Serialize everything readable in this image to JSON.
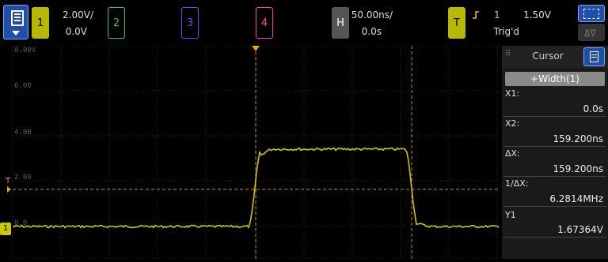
{
  "menu": {
    "icon": "menu-icon"
  },
  "channels": [
    {
      "num": "1",
      "color": "#c8c800",
      "scale": "2.00V/",
      "offset": "0.0V"
    },
    {
      "num": "2",
      "color": "#2ecc40"
    },
    {
      "num": "3",
      "color": "#3d5cff"
    },
    {
      "num": "4",
      "color": "#ff3ca0"
    }
  ],
  "horizontal": {
    "key": "H",
    "scale": "50.00ns/",
    "delay": "0.0s"
  },
  "trigger": {
    "key": "T",
    "source": "1",
    "level": "1.50V",
    "status": "Trig'd"
  },
  "grid_labels": [
    "8.00V",
    "6.00",
    "4.00",
    "2.00",
    "0.0"
  ],
  "markers": {
    "ground": "1",
    "trigger": "T"
  },
  "cursor_panel": {
    "title": "Cursor",
    "mode": "+Width(1)",
    "rows": [
      {
        "label": "X1:",
        "value": "0.0s"
      },
      {
        "label": "X2:",
        "value": "159.200ns"
      },
      {
        "label": "ΔX:",
        "value": "159.200ns"
      },
      {
        "label": "1/ΔX:",
        "value": "6.2814MHz"
      },
      {
        "label": "Y1",
        "value": "1.67364V"
      }
    ]
  }
}
